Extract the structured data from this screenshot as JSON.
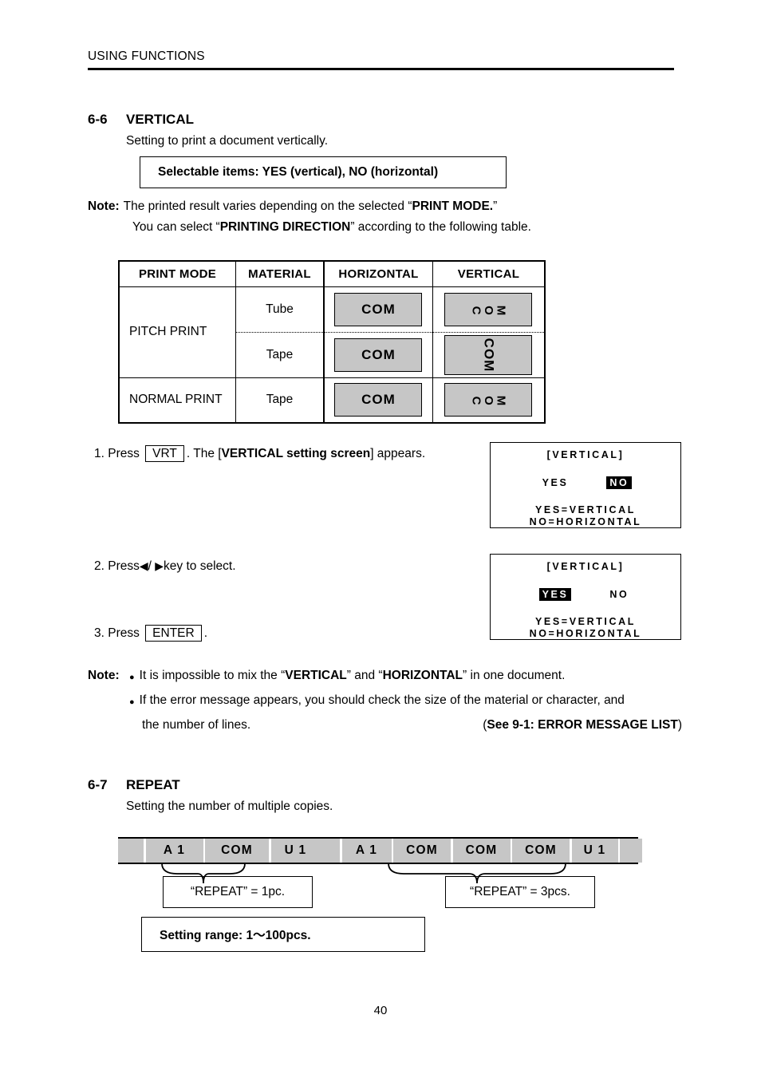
{
  "header": {
    "title": "USING FUNCTIONS"
  },
  "page_number": "40",
  "section_vertical": {
    "number": "6-6",
    "title": "VERTICAL",
    "subtitle": "Setting to print a document vertically.",
    "selectable_box": "Selectable items: YES (vertical),     NO (horizontal)",
    "note_label": "Note:",
    "note_line1_a": "The printed result varies depending on the selected “",
    "note_line1_b": "PRINT MODE.",
    "note_line1_c": "”",
    "note_line2_a": "You can select “",
    "note_line2_b": "PRINTING DIRECTION",
    "note_line2_c": "” according to the following table."
  },
  "table": {
    "headers": [
      "PRINT MODE",
      "MATERIAL",
      "HORIZONTAL",
      "VERTICAL"
    ],
    "rows": [
      {
        "mode": "PITCH PRINT",
        "material": "Tube",
        "horizontal": "COM",
        "vertical": "COM",
        "vertical_style": "rotated-letters"
      },
      {
        "mode": "",
        "material": "Tape",
        "horizontal": "COM",
        "vertical": "COM",
        "vertical_style": "rotated-word"
      },
      {
        "mode": "NORMAL PRINT",
        "material": "Tape",
        "horizontal": "COM",
        "vertical": "COM",
        "vertical_style": "rotated-letters"
      }
    ]
  },
  "steps": [
    {
      "prefix": "1. Press",
      "key": "VRT",
      "suffix_a": ". The [",
      "suffix_b": "VERTICAL setting screen",
      "suffix_c": "] appears."
    },
    {
      "prefix": "2. Press",
      "arrow_left": "◀",
      "slash": "/",
      "arrow_right": "▶",
      "suffix_a": "key to select."
    },
    {
      "prefix": "3. Press",
      "key": "ENTER",
      "suffix_a": "."
    }
  ],
  "lcd_screens": [
    {
      "title": "[VERTICAL]",
      "option_yes": "YES",
      "option_no": "NO",
      "selected": "NO",
      "foot1": "YES=VERTICAL",
      "foot2": "NO=HORIZONTAL"
    },
    {
      "title": "[VERTICAL]",
      "option_yes": "YES",
      "option_no": "NO",
      "selected": "YES",
      "foot1": "YES=VERTICAL",
      "foot2": "NO=HORIZONTAL"
    }
  ],
  "note_bottom": {
    "label": "Note:",
    "bullet1_a": "It is impossible to mix the “",
    "bullet1_b": "VERTICAL",
    "bullet1_c": "” and “",
    "bullet1_d": "HORIZONTAL",
    "bullet1_e": "” in one document.",
    "bullet2_a": "If the error message appears, you should check the size of the material or character, and",
    "bullet2_b": "the number of lines.",
    "reference_open": "(",
    "reference": "See 9-1: ERROR MESSAGE LIST",
    "reference_close": ")"
  },
  "section_repeat": {
    "number": "6-7",
    "title": "REPEAT",
    "subtitle": "Setting the number of multiple copies.",
    "range_box": "Setting range: 1～100pcs.",
    "strip_1": {
      "segments": [
        "",
        "A 1",
        "COM",
        "U 1",
        ""
      ],
      "callout": "“REPEAT” = 1pc."
    },
    "strip_2": {
      "segments": [
        "",
        "A 1",
        "COM",
        "COM",
        "COM",
        "U 1",
        ""
      ],
      "callout": "“REPEAT” = 3pcs."
    }
  },
  "colors": {
    "chip_gray": "#c6c6c6",
    "ink": "#000000",
    "paper": "#ffffff"
  }
}
